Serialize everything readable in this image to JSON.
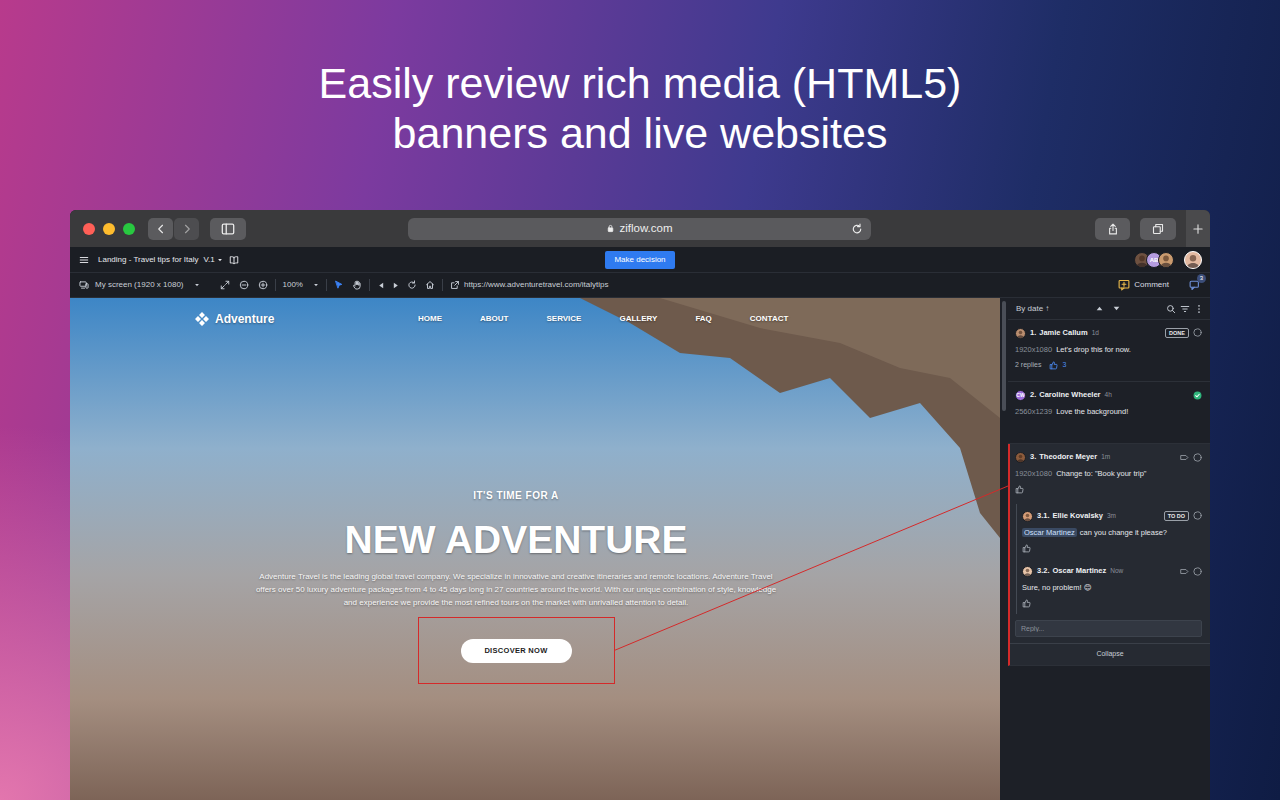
{
  "headline": {
    "lines": [
      "Easily review rich media (HTML5)",
      "banners and live websites"
    ]
  },
  "browser": {
    "address": "ziflow.com"
  },
  "app": {
    "title": "Landing - Travel tips for Italy",
    "version": "V.1",
    "decision_button": "Make decision",
    "reviewers": [
      {
        "kind": "photo",
        "color": "#6e5140"
      },
      {
        "kind": "initials",
        "initials": "AB",
        "color": "#b59ce0"
      },
      {
        "kind": "photo",
        "color": "#c99a6e"
      },
      {
        "kind": "photo",
        "color": "#e3b9a0"
      }
    ]
  },
  "toolbar": {
    "screen": "My screen (1920 x 1080)",
    "zoom": "100%",
    "tools": [
      {
        "kind": "select",
        "selected": true
      },
      {
        "kind": "pan",
        "selected": false
      }
    ],
    "url": "https://www.adventuretravel.com/italytips",
    "comment_button": "Comment",
    "comment_count": "3"
  },
  "site": {
    "brand": "Adventure",
    "nav": [
      "HOME",
      "ABOUT",
      "SERVICE",
      "GALLERY",
      "FAQ",
      "CONTACT"
    ],
    "eyebrow": "IT'S TIME FOR A",
    "heading": "NEW ADVENTURE",
    "body": "Adventure Travel is the leading global travel company. We specialize in innovative and creative itineraries and remote locations. Adventure Travel offers over 50 luxury adventure packages from 4 to 45 days long in 27 countries around the world. With our unique combination of style, knowledge and experience we provide the most refined tours on the market with unrivalled attention to detail.",
    "cta": "DISCOVER NOW"
  },
  "comments": {
    "sort": "By date ↑",
    "items": [
      {
        "number": "1.",
        "author": "Jamie Callum",
        "avatar": {
          "kind": "photo",
          "color": "#b98d6f"
        },
        "time": "1d",
        "status": "DONE",
        "labeled": false,
        "resolved": false,
        "selected": false,
        "screen": "1920x1080",
        "text": "Let's drop this for now.",
        "replies": "2 replies",
        "liked": true,
        "likes": "3"
      },
      {
        "number": "2.",
        "author": "Caroline Wheeler",
        "avatar": {
          "kind": "initials",
          "initials": "CW",
          "color": "#9d6ddb"
        },
        "time": "4h",
        "labeled": false,
        "resolved": true,
        "selected": false,
        "screen": "2560x1239",
        "text": "Love the background!"
      },
      {
        "number": "3.",
        "author": "Theodore Meyer",
        "avatar": {
          "kind": "photo",
          "color": "#8c5b3c"
        },
        "time": "1m",
        "labeled": true,
        "resolved": false,
        "selected": true,
        "screen": "1920x1080",
        "text": "Change to: \"Book your trip\"",
        "liked": false,
        "thread": [
          {
            "number": "3.1.",
            "author": "Ellie Kovalsky",
            "avatar": {
              "kind": "photo",
              "color": "#d39b76"
            },
            "time": "3m",
            "status": "TO DO",
            "labeled": false,
            "resolved": false,
            "mention": "Oscar Martinez",
            "text": "can you change it please?",
            "liked": false
          },
          {
            "number": "3.2.",
            "author": "Oscar Martinez",
            "avatar": {
              "kind": "photo",
              "color": "#e6c3a8"
            },
            "time": "Now",
            "labeled": true,
            "resolved": false,
            "text": "Sure, no problem! 😊",
            "liked": false
          }
        ]
      }
    ],
    "reply_placeholder": "Reply...",
    "collapse": "Collapse"
  }
}
